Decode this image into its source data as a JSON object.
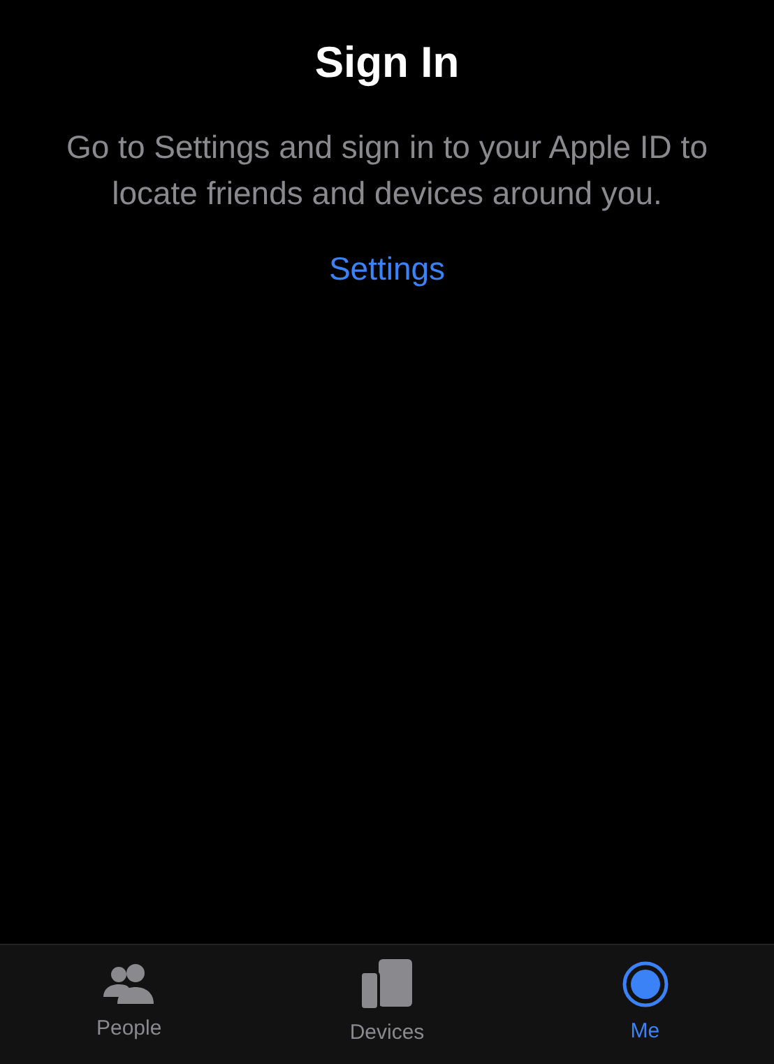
{
  "title": "Sign In",
  "message": "Go to Settings and sign in to your Apple ID to locate friends and devices around you.",
  "link": "Settings",
  "tabs": [
    {
      "kind": "people",
      "label": "People",
      "selected": false
    },
    {
      "kind": "devices",
      "label": "Devices",
      "selected": false
    },
    {
      "kind": "me",
      "label": "Me",
      "selected": true
    }
  ]
}
